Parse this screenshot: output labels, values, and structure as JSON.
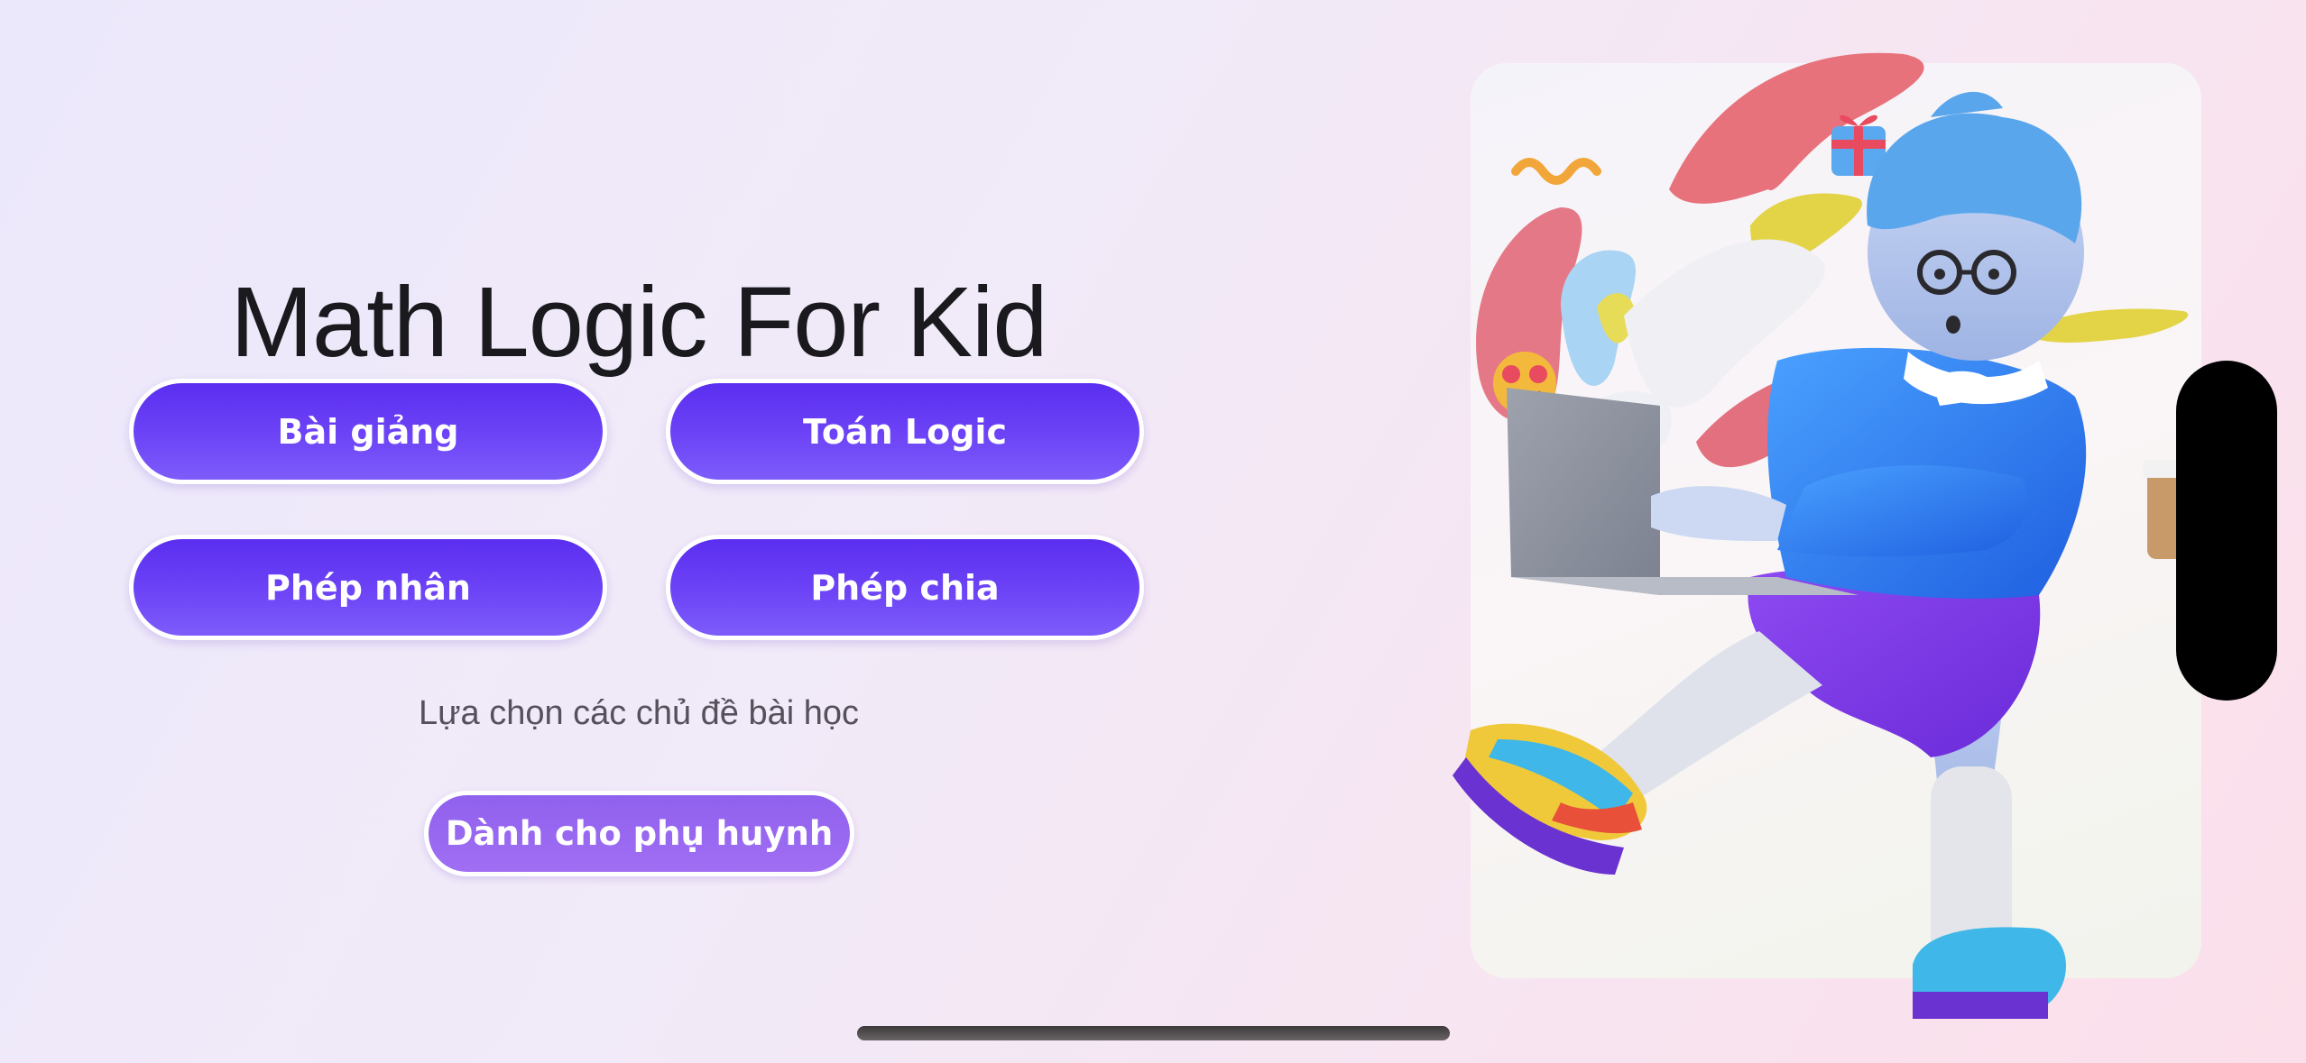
{
  "app": {
    "title": "Math Logic For Kid"
  },
  "menu": {
    "buttons": [
      {
        "label": "Bài giảng"
      },
      {
        "label": "Toán Logic"
      },
      {
        "label": "Phép nhân"
      },
      {
        "label": "Phép chia"
      }
    ],
    "hint": "Lựa chọn các chủ đề bài học",
    "parent_button": "Dành cho phụ huynh"
  },
  "illustration": {
    "icon": "kid-with-laptop-illustration"
  },
  "colors": {
    "primary_button": "#6236f2",
    "parent_button": "#9a69f1",
    "title_text": "#1a1a1e",
    "background_start": "#ece8fb",
    "background_end": "#fbdfea"
  }
}
